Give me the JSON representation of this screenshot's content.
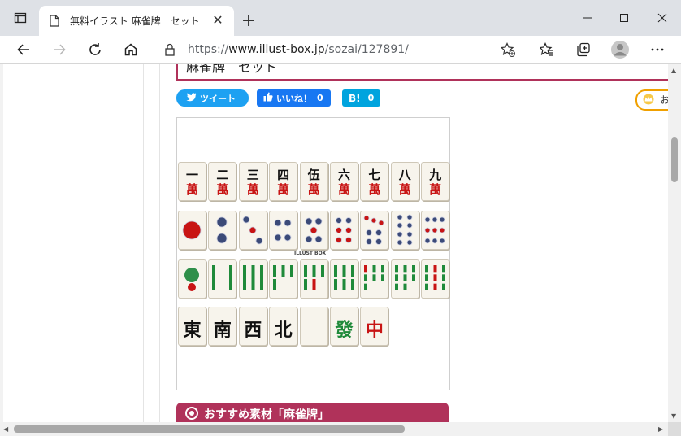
{
  "browser": {
    "tab_title": "無料イラスト 麻雀牌　セット",
    "url_prefix": "https://",
    "url_host": "www.illust-box.jp",
    "url_path": "/sozai/127891/"
  },
  "page": {
    "heading": "麻雀牌　セット",
    "share": {
      "tweet": "ツイート",
      "like": "いいね！",
      "like_count": "0",
      "hatena": "B!",
      "hatena_count": "0",
      "badge": "お"
    },
    "watermark": "ILLUST BOX",
    "recommend": "おすすめ素材「麻雀牌」"
  },
  "tiles": {
    "manzu": [
      {
        "top": "一",
        "bot": "萬"
      },
      {
        "top": "二",
        "bot": "萬"
      },
      {
        "top": "三",
        "bot": "萬"
      },
      {
        "top": "四",
        "bot": "萬"
      },
      {
        "top": "伍",
        "bot": "萬"
      },
      {
        "top": "六",
        "bot": "萬"
      },
      {
        "top": "七",
        "bot": "萬"
      },
      {
        "top": "八",
        "bot": "萬"
      },
      {
        "top": "九",
        "bot": "萬"
      }
    ],
    "honors": [
      {
        "char": "東",
        "color": "#111111"
      },
      {
        "char": "南",
        "color": "#111111"
      },
      {
        "char": "西",
        "color": "#111111"
      },
      {
        "char": "北",
        "color": "#111111"
      },
      {
        "char": "",
        "color": "#111111"
      },
      {
        "char": "發",
        "color": "#1f8a3a"
      },
      {
        "char": "中",
        "color": "#c81414"
      }
    ]
  },
  "colors": {
    "accent": "#b0325a",
    "twitter": "#1da1f2",
    "facebook": "#1877f2",
    "hatena": "#00a4de"
  }
}
